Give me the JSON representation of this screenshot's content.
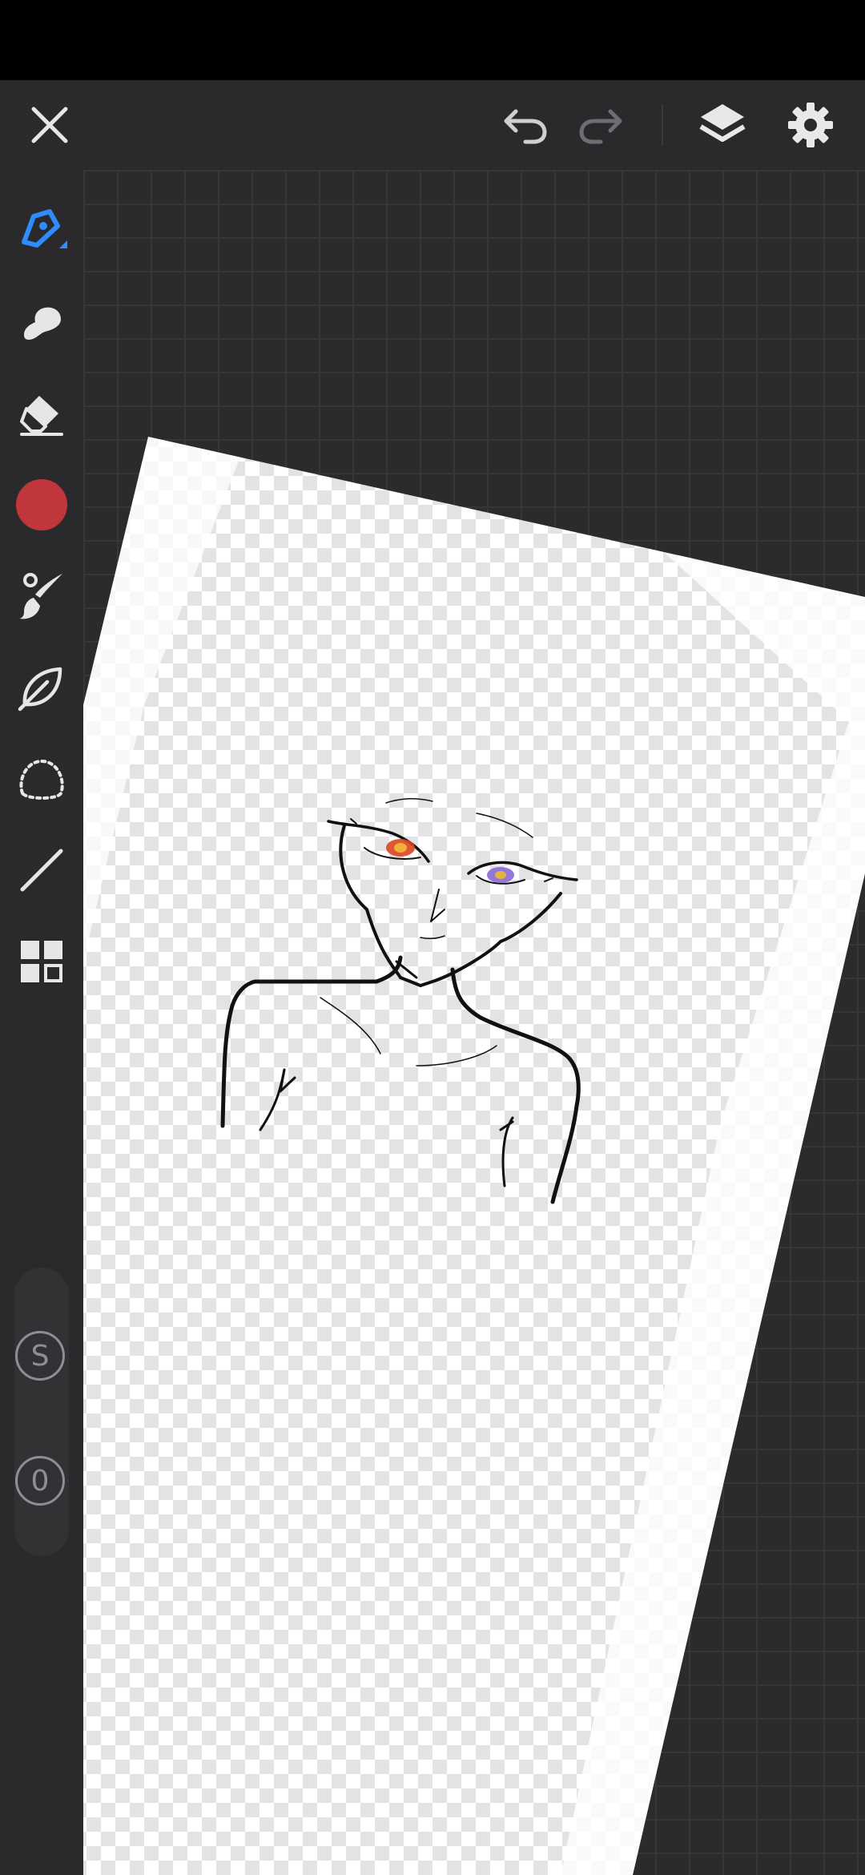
{
  "app": {
    "toolbar": {
      "close_icon": "close-icon",
      "undo_icon": "undo-icon",
      "redo_icon": "redo-icon",
      "layers_icon": "layers-icon",
      "settings_icon": "gear-icon"
    },
    "tools": [
      {
        "name": "pen-tool",
        "icon": "pen-icon",
        "active": true
      },
      {
        "name": "smudge-tool",
        "icon": "smudge-icon"
      },
      {
        "name": "eraser-tool",
        "icon": "eraser-icon"
      },
      {
        "name": "color-picker",
        "icon": "color-swatch",
        "color": "#c1363a"
      },
      {
        "name": "brush-tool",
        "icon": "brush-icon"
      },
      {
        "name": "lasso-fill-tool",
        "icon": "leaf-icon"
      },
      {
        "name": "selection-tool",
        "icon": "dotted-selection-icon"
      },
      {
        "name": "line-tool",
        "icon": "line-icon"
      },
      {
        "name": "more-tools",
        "icon": "grid-icon"
      }
    ],
    "brush_size_label": "S",
    "opacity_label": "0",
    "colors": {
      "accent": "#2f8cff",
      "current_color": "#c1363a",
      "toolbar_bg": "#2a2a2c",
      "workspace_bg": "#2b2b2d"
    }
  }
}
